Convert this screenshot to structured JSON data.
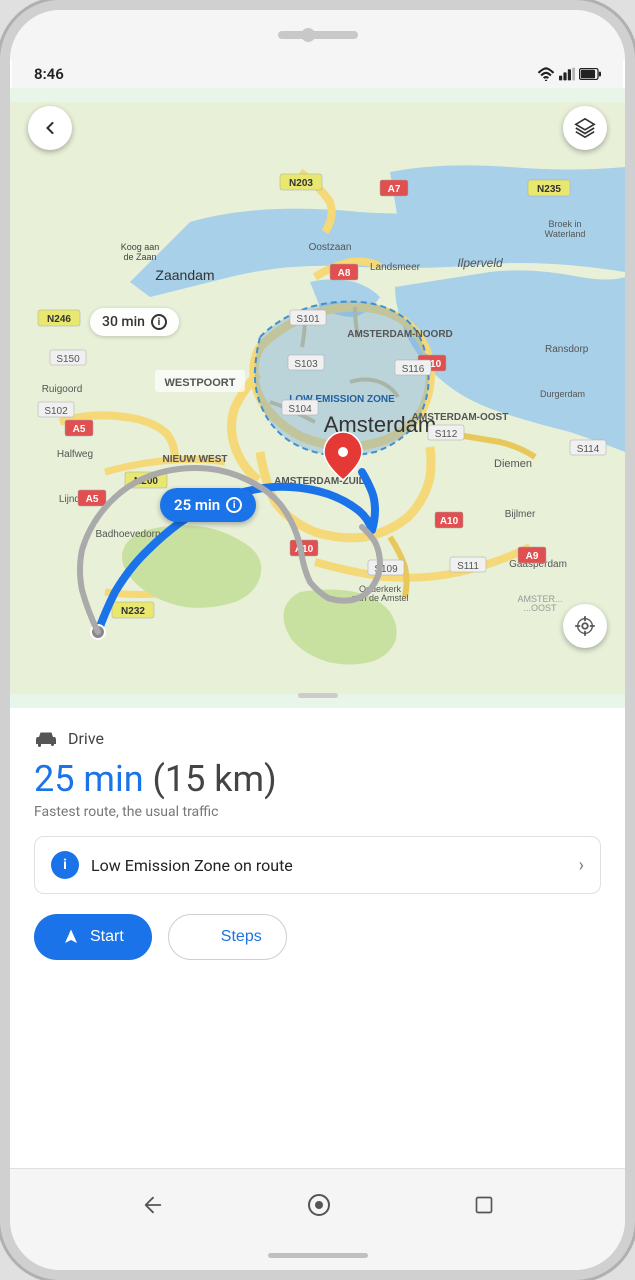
{
  "status_bar": {
    "time": "8:46",
    "wifi_icon": "wifi",
    "signal_icon": "signal",
    "battery_icon": "battery"
  },
  "map": {
    "route_badge_1": {
      "duration": "30 min"
    },
    "route_badge_2": {
      "duration": "25 min"
    },
    "back_button_label": "back",
    "layers_button_label": "layers",
    "location_button_label": "my location"
  },
  "bottom_panel": {
    "drive_label": "Drive",
    "route_time": "25 min",
    "route_distance": "(15 km)",
    "route_description": "Fastest route, the usual traffic",
    "lez_text": "Low Emission Zone on route",
    "start_button": "Start",
    "steps_button": "Steps"
  },
  "nav_bar": {
    "back_label": "back",
    "home_label": "home",
    "recent_label": "recent apps"
  }
}
